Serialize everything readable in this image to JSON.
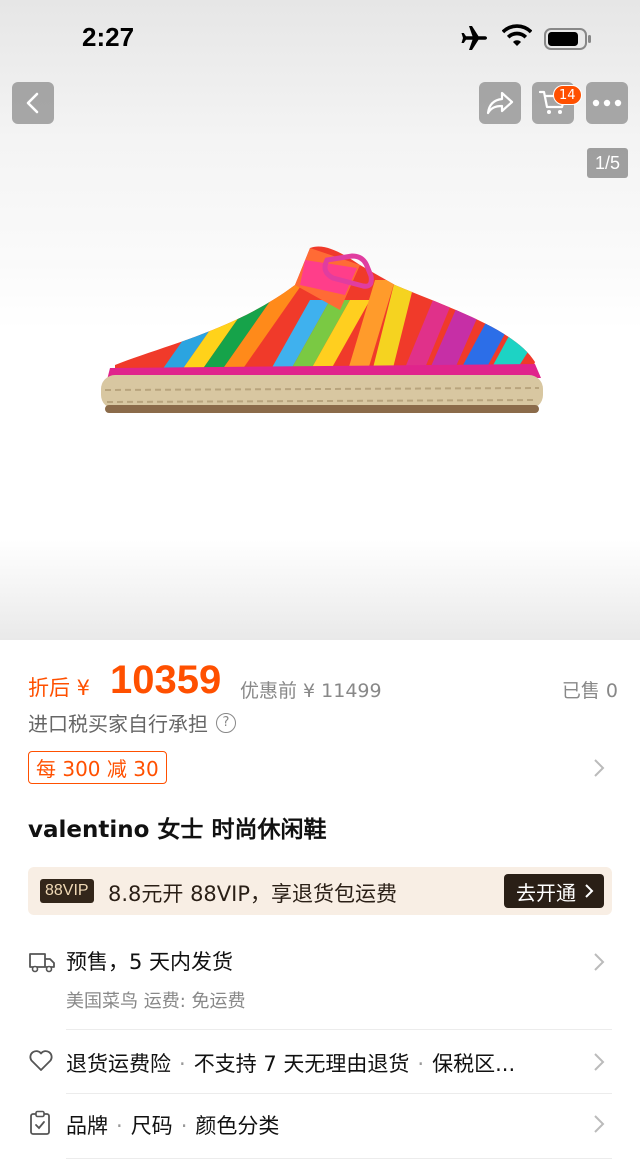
{
  "status_bar": {
    "time": "2:27"
  },
  "nav": {
    "cart_count": "14",
    "page_indicator": "1/5"
  },
  "price": {
    "prefix": "折后 ¥",
    "value": "10359",
    "original": "优惠前 ¥ 11499",
    "sold": "已售 0"
  },
  "tax_note": "进口税买家自行承担",
  "coupon": "每 300 减 30",
  "product_title": "valentino 女士 时尚休闲鞋",
  "vip": {
    "tag": "88VIP",
    "text": "8.8元开 88VIP，享退货包运费",
    "cta": "去开通"
  },
  "shipping": {
    "main": "预售，5 天内发货",
    "sub": "美国菜鸟  运费: 免运费"
  },
  "service": {
    "items": [
      "退货运费险",
      "不支持 7 天无理由退货",
      "保税区..."
    ]
  },
  "params": {
    "items": [
      "品牌",
      "尺码",
      "颜色分类"
    ]
  },
  "colors": {
    "accent": "#ff5000",
    "vip_dark": "#2a1f16",
    "vip_bg": "#f8eee4"
  }
}
